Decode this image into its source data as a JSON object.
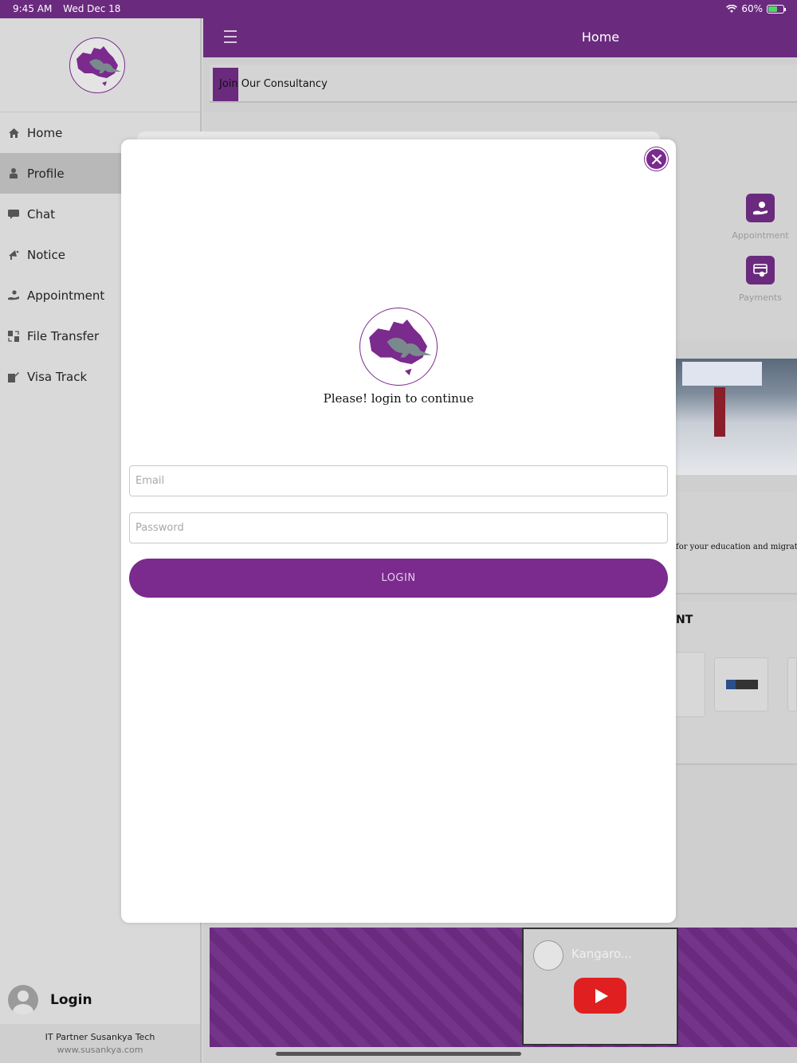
{
  "status_bar": {
    "time": "9:45 AM",
    "date": "Wed Dec 18",
    "battery": "60%",
    "battery_level": 0.6
  },
  "sidebar": {
    "items": [
      {
        "label": "Home",
        "icon": "home-icon",
        "active": false
      },
      {
        "label": "Profile",
        "icon": "user-icon",
        "active": true
      },
      {
        "label": "Chat",
        "icon": "chat-icon",
        "active": false
      },
      {
        "label": "Notice",
        "icon": "megaphone-icon",
        "active": false
      },
      {
        "label": "Appointment",
        "icon": "hand-user-icon",
        "active": false
      },
      {
        "label": "File Transfer",
        "icon": "file-transfer-icon",
        "active": false
      },
      {
        "label": "Visa Track",
        "icon": "visa-track-icon",
        "active": false
      }
    ],
    "login_label": "Login",
    "footer_line1": "IT Partner  Susankya Tech",
    "footer_line2": "www.susankya.com"
  },
  "header": {
    "title": "Home"
  },
  "main": {
    "join_text": "Join Our Consultancy",
    "appointment_label": "Appointment",
    "payments_label": "Payments",
    "text_strip_copy": "for your education and migratio",
    "partner_title": "NT",
    "video_title": "Kangaro..."
  },
  "modal": {
    "heading": "Please! login to continue",
    "email_placeholder": "Email",
    "password_placeholder": "Password",
    "login_label": "LOGIN"
  },
  "colors": {
    "brand_purple": "#6a2a7e",
    "button_purple": "#7b2a8e"
  }
}
